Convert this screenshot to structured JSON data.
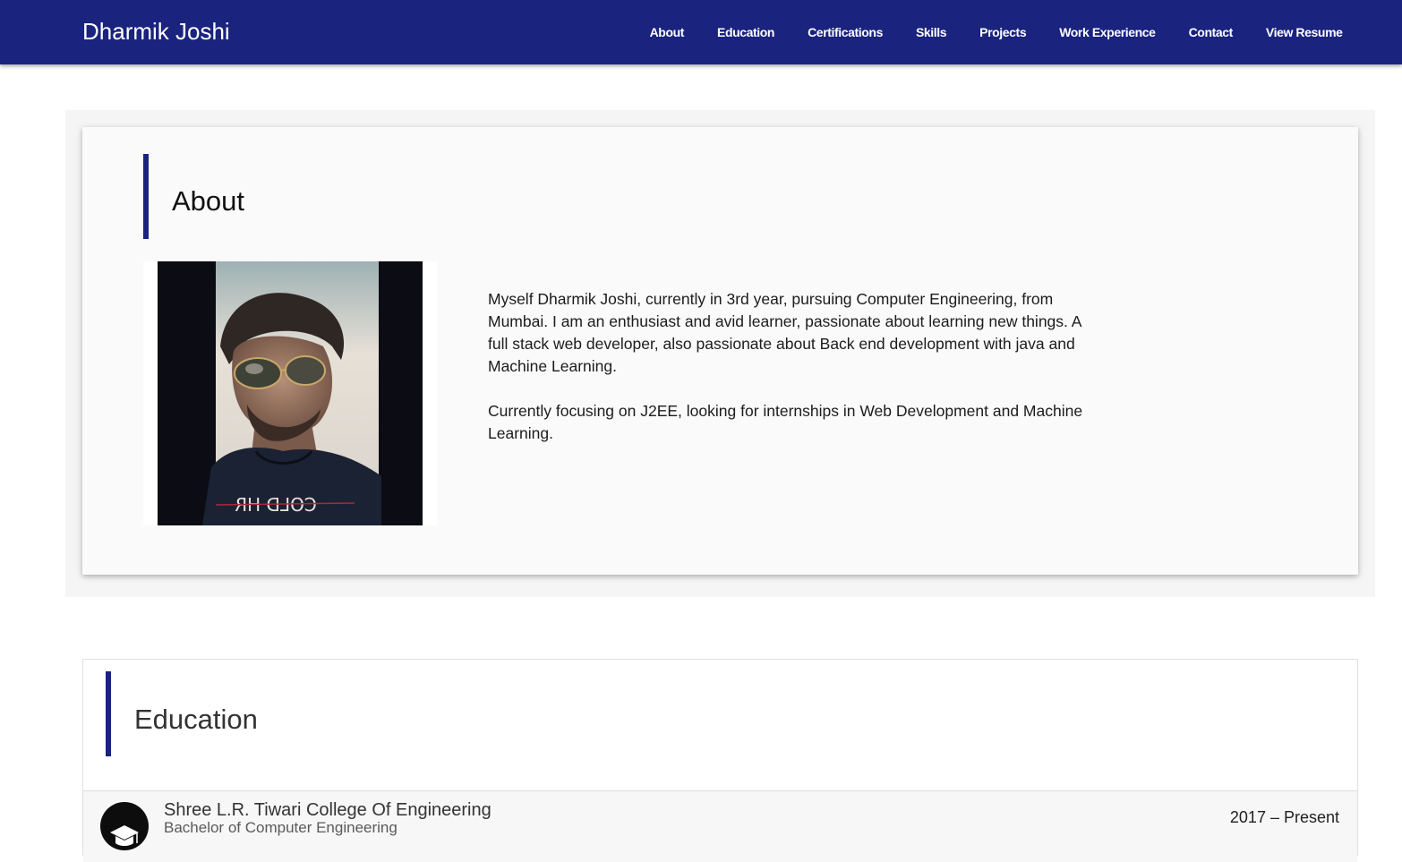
{
  "navbar": {
    "brand": "Dharmik Joshi",
    "links": [
      {
        "label": "About"
      },
      {
        "label": "Education"
      },
      {
        "label": "Certifications"
      },
      {
        "label": "Skills"
      },
      {
        "label": "Projects"
      },
      {
        "label": "Work Experience"
      },
      {
        "label": "Contact"
      },
      {
        "label": "View Resume"
      }
    ]
  },
  "about": {
    "title": "About",
    "photo_icon": "profile-photo",
    "shirt_text": "COLD HR",
    "paragraphs": [
      "Myself Dharmik Joshi, currently in 3rd year, pursuing Computer Engineering, from Mumbai. I am an enthusiast and avid learner, passionate about learning new things. A full stack web developer, also passionate about Back end development with java and Machine Learning.",
      "Currently focusing on J2EE, looking for internships in Web Development and Machine Learning."
    ]
  },
  "education": {
    "title": "Education",
    "items": [
      {
        "icon": "graduation-cap-icon",
        "school": "Shree L.R. Tiwari College Of Engineering",
        "degree": "Bachelor of Computer Engineering",
        "period": "2017 – Present"
      }
    ]
  },
  "colors": {
    "primary": "#1a237e",
    "section_bg": "#f5f5f5",
    "card_bg": "#fafafa"
  }
}
